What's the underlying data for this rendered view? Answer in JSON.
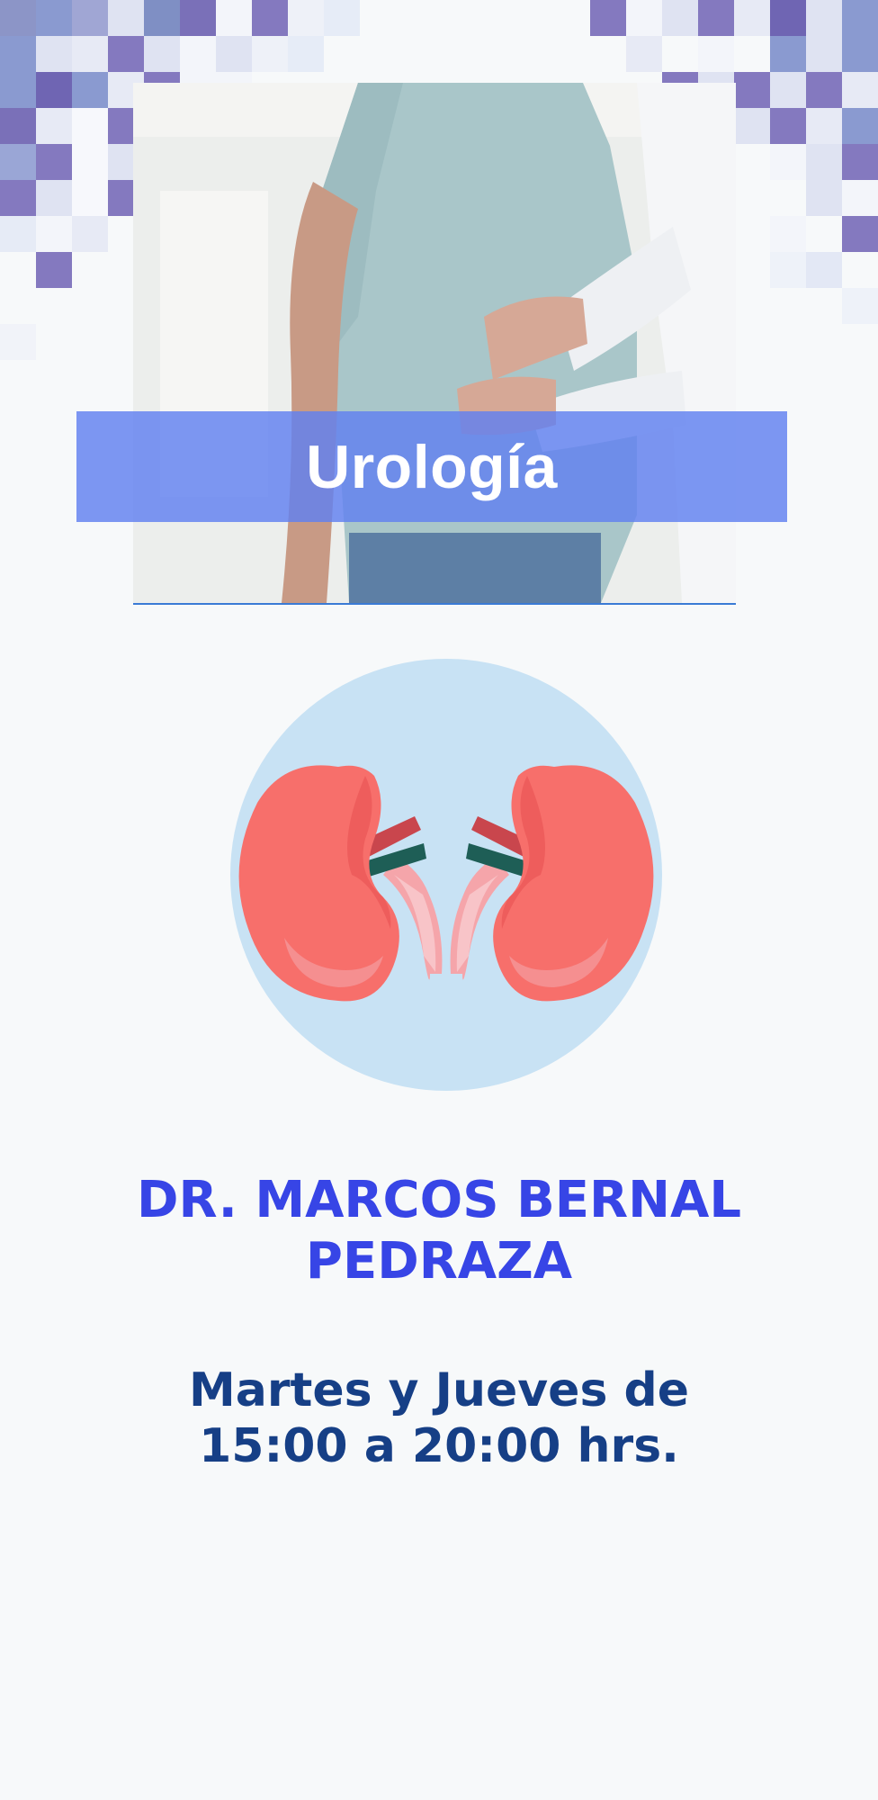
{
  "specialty": {
    "title": "Urología"
  },
  "doctor": {
    "line1": "DR. MARCOS BERNAL",
    "line2": "PEDRAZA"
  },
  "schedule": {
    "line1": "Martes y Jueves de",
    "line2": "15:00 a 20:00 hrs."
  },
  "colors": {
    "background": "#f7f9fa",
    "title_band": "#6080f0",
    "doctor_text": "#3745e6",
    "schedule_text": "#163f86",
    "icon_circle": "#c8e2f4",
    "kidney": "#f76f6b",
    "mosaic_dark": "#7a70b8",
    "mosaic_light": "#dfe3f2"
  },
  "icons": [
    "kidneys-icon"
  ],
  "images": [
    "patient-back-pain-photo"
  ]
}
